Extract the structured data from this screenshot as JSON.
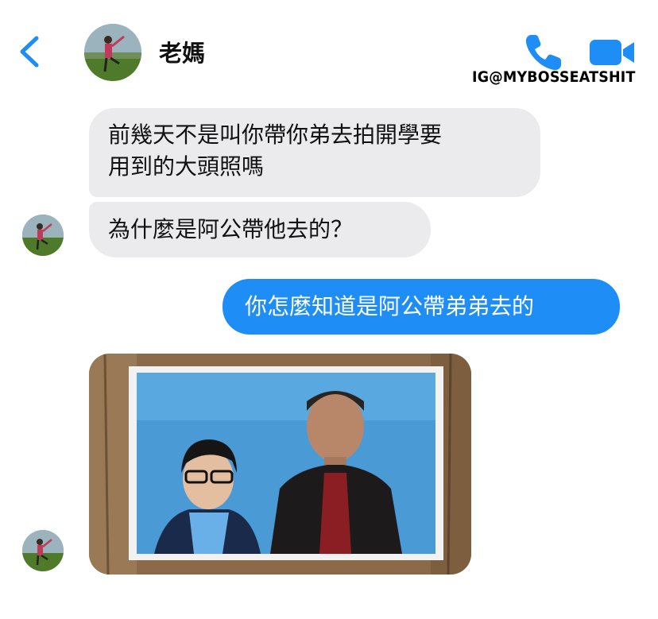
{
  "header": {
    "contact_name": "老媽",
    "watermark": "IG@MYBOSSEATSHIT",
    "icons": [
      "back-chevron-icon",
      "phone-icon",
      "video-camera-icon"
    ],
    "accent_color": "#1e8ef6"
  },
  "messages": [
    {
      "sender": "contact",
      "text": "前幾天不是叫你帶你弟去拍開學要\n用到的大頭照嗎"
    },
    {
      "sender": "contact",
      "text": "為什麼是阿公帶他去的？"
    },
    {
      "sender": "self",
      "text": "你怎麼知道是阿公帶弟弟去的"
    },
    {
      "sender": "contact",
      "type": "photo"
    }
  ],
  "colors": {
    "incoming_bubble": "#ebebed",
    "outgoing_bubble": "#1e8ef6"
  }
}
